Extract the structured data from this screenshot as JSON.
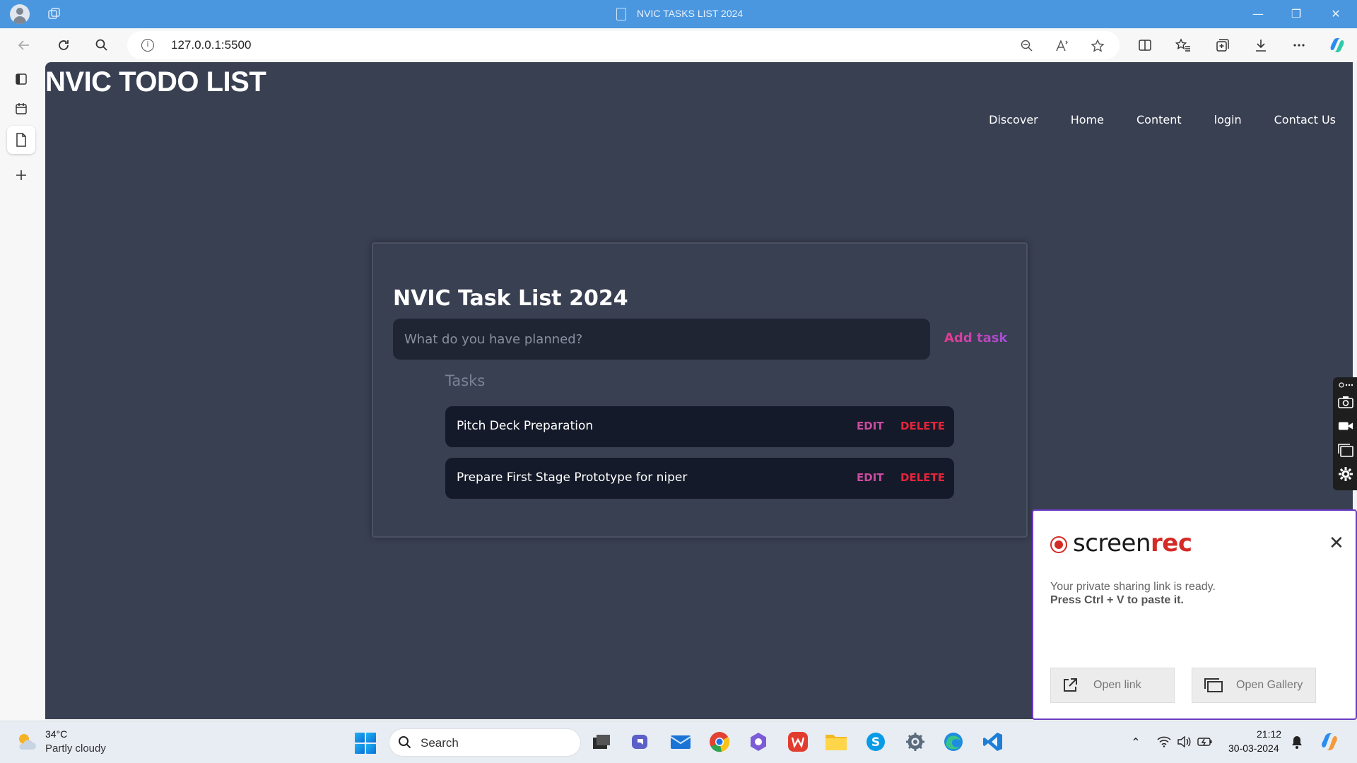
{
  "browser": {
    "tab_title": "NVIC TASKS LIST 2024",
    "url": "127.0.0.1:5500"
  },
  "site": {
    "title": "NVIC TODO LIST",
    "nav": [
      "Discover",
      "Home",
      "Content",
      "login",
      "Contact Us"
    ]
  },
  "card": {
    "title": "NVIC Task List 2024",
    "input_placeholder": "What do you have planned?",
    "add_button": "Add task",
    "tasks_label": "Tasks",
    "tasks": [
      {
        "text": "Pitch Deck Preparation",
        "edit": "EDIT",
        "delete": "DELETE"
      },
      {
        "text": "Prepare First Stage Prototype for niper",
        "edit": "EDIT",
        "delete": "DELETE"
      }
    ]
  },
  "screenrec": {
    "brand_screen": "screen",
    "brand_rec": "rec",
    "message": "Your private sharing link is ready.",
    "instruction": "Press Ctrl + V to paste it.",
    "open_link": "Open link",
    "open_gallery": "Open Gallery",
    "close_symbol": "✕"
  },
  "taskbar": {
    "temperature": "34°C",
    "weather": "Partly cloudy",
    "search_label": "Search",
    "time": "21:12",
    "date": "30-03-2024"
  },
  "colors": {
    "page_bg": "#394052",
    "task_bg": "#141a29",
    "edit": "#c94c9e",
    "delete": "#e5243b",
    "screenrec_red": "#d42a26",
    "titlebar": "#4a97e0"
  }
}
